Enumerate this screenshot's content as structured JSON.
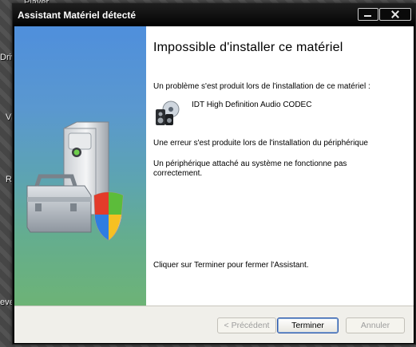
{
  "desktop": {
    "labels": [
      "Player",
      "Driv",
      "Vi",
      "R",
      "eve"
    ]
  },
  "window": {
    "title": "Assistant Matériel détecté"
  },
  "content": {
    "heading": "Impossible d'installer ce matériel",
    "problem_text": "Un problème s'est produit lors de l'installation de ce matériel :",
    "device_name": "IDT High Definition Audio CODEC",
    "error_text": "Une erreur s'est produite lors de l'installation du périphérique",
    "detail_text": "Un périphérique attaché au système ne fonctionne pas correctement.",
    "finish_hint": "Cliquer sur Terminer pour fermer l'Assistant."
  },
  "buttons": {
    "back": "< Précédent",
    "finish": "Terminer",
    "cancel": "Annuler"
  },
  "colors": {
    "panel_top": "#4f8fdc",
    "panel_bottom": "#6db376",
    "titlebar": "#050505"
  },
  "icons": {
    "device": "audio-device-icon",
    "wizard": "hardware-toolbox-shield-icon"
  }
}
